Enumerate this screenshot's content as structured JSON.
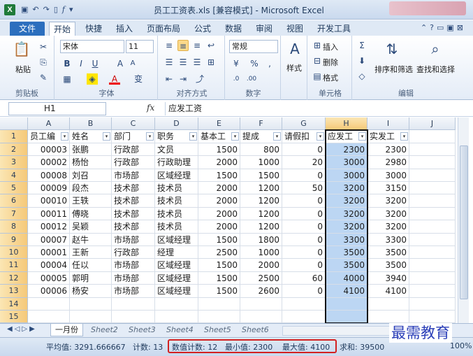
{
  "window": {
    "title": "员工工资表.xls [兼容模式] - Microsoft Excel",
    "app_icon": "X"
  },
  "quick_access": {
    "save_icon": "save-icon",
    "undo_icon": "undo-icon",
    "redo_icon": "redo-icon",
    "new_icon": "new-icon",
    "fx_icon": "fx-icon"
  },
  "ribbon_tabs": [
    "文件",
    "开始",
    "快捷",
    "插入",
    "页面布局",
    "公式",
    "数据",
    "审阅",
    "视图",
    "开发工具"
  ],
  "ribbon": {
    "clipboard": {
      "paste_label": "粘贴",
      "group_label": "剪贴板"
    },
    "font": {
      "font_name": "宋体",
      "font_size": "11",
      "group_label": "字体",
      "bold": "B",
      "italic": "I",
      "underline": "U",
      "wen": "变"
    },
    "alignment": {
      "group_label": "对齐方式"
    },
    "number": {
      "format": "常规",
      "group_label": "数字",
      "percent": "%",
      "comma": ","
    },
    "styles": {
      "label": "样式"
    },
    "cells": {
      "insert": "插入",
      "delete": "删除",
      "format": "格式",
      "group_label": "单元格"
    },
    "editing": {
      "sort_filter": "排序和筛选",
      "find_select": "查找和选择",
      "group_label": "编辑",
      "sigma": "Σ"
    }
  },
  "formula_bar": {
    "name_box": "H1",
    "fx": "fx",
    "content": "应发工资"
  },
  "columns": [
    "A",
    "B",
    "C",
    "D",
    "E",
    "F",
    "G",
    "H",
    "I",
    "J"
  ],
  "headers": [
    "员工编",
    "姓名",
    "部门",
    "职务",
    "基本工",
    "提成",
    "请假扣",
    "应发工",
    "实发工"
  ],
  "rows": [
    [
      "00003",
      "张鹏",
      "行政部",
      "文员",
      "1500",
      "800",
      "0",
      "2300",
      "2300"
    ],
    [
      "00002",
      "杨怡",
      "行政部",
      "行政助理",
      "2000",
      "1000",
      "20",
      "3000",
      "2980"
    ],
    [
      "00008",
      "刘召",
      "市场部",
      "区域经理",
      "1500",
      "1500",
      "0",
      "3000",
      "3000"
    ],
    [
      "00009",
      "段杰",
      "技术部",
      "技术员",
      "2000",
      "1200",
      "50",
      "3200",
      "3150"
    ],
    [
      "00010",
      "王轶",
      "技术部",
      "技术员",
      "2000",
      "1200",
      "0",
      "3200",
      "3200"
    ],
    [
      "00011",
      "傅晓",
      "技术部",
      "技术员",
      "2000",
      "1200",
      "0",
      "3200",
      "3200"
    ],
    [
      "00012",
      "吴颖",
      "技术部",
      "技术员",
      "2000",
      "1200",
      "0",
      "3200",
      "3200"
    ],
    [
      "00007",
      "赵牛",
      "市场部",
      "区域经理",
      "1500",
      "1800",
      "0",
      "3300",
      "3300"
    ],
    [
      "00001",
      "王新",
      "行政部",
      "经理",
      "2500",
      "1000",
      "0",
      "3500",
      "3500"
    ],
    [
      "00004",
      "任以",
      "市场部",
      "区域经理",
      "1500",
      "2000",
      "0",
      "3500",
      "3500"
    ],
    [
      "00005",
      "郭明",
      "市场部",
      "区域经理",
      "1500",
      "2500",
      "60",
      "4000",
      "3940"
    ],
    [
      "00006",
      "杨安",
      "市场部",
      "区域经理",
      "1500",
      "2600",
      "0",
      "4100",
      "4100"
    ]
  ],
  "row_numbers": [
    "1",
    "2",
    "3",
    "4",
    "5",
    "6",
    "7",
    "8",
    "9",
    "10",
    "11",
    "12",
    "13",
    "14",
    "15"
  ],
  "sheets": [
    "一月份",
    "Sheet2",
    "Sheet3",
    "Sheet4",
    "Sheet5",
    "Sheet6"
  ],
  "status": {
    "average": "平均值: 3291.666667",
    "count": "计数: 13",
    "num_count": "数值计数: 12",
    "min": "最小值: 2300",
    "max": "最大值: 4100",
    "sum": "求和: 39500",
    "zoom": "100%"
  },
  "watermark": "最需教育",
  "colors": {
    "accent": "#2c6fbe",
    "selection": "#bcd6f3",
    "highlight_box": "#d32121"
  }
}
